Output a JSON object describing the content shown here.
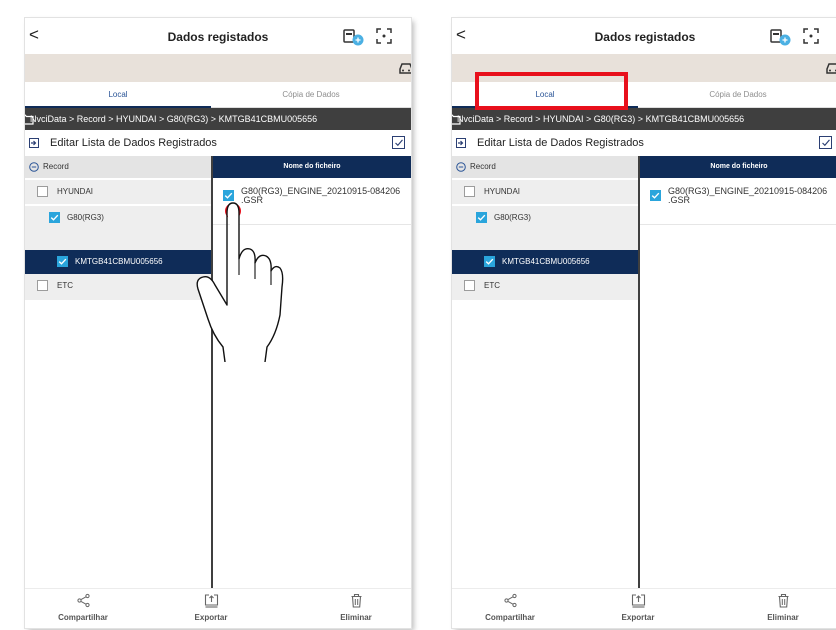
{
  "panels": [
    {
      "title": "Dados registados",
      "back": "<",
      "tabs": {
        "local": "Local",
        "copy": "Cópia de Dados"
      },
      "path": "NvciData > Record > HYUNDAI > G80(RG3) > KMTGB41CBMU005656",
      "edit_label": "Editar Lista de Dados Registrados",
      "tree": {
        "root": "Record",
        "items": [
          {
            "label": "HYUNDAI",
            "checked": false
          },
          {
            "label": "G80(RG3)",
            "checked": true
          },
          {
            "label": "KMTGB41CBMU005656",
            "checked": true,
            "selected": true
          },
          {
            "label": "ETC",
            "checked": false
          }
        ]
      },
      "file_header": "Nome do ficheiro",
      "file_name": "G80(RG3)_ENGINE_20210915-084206\n.GSR",
      "bottom": {
        "share": "Compartilhar",
        "export": "Exportar",
        "delete": "Eliminar"
      }
    },
    {
      "title": "Dados registados",
      "back": "<",
      "tabs": {
        "local": "Local",
        "copy": "Cópia de Dados"
      },
      "path": "NvciData > Record > HYUNDAI > G80(RG3) > KMTGB41CBMU005656",
      "edit_label": "Editar Lista de Dados Registrados",
      "tree": {
        "root": "Record",
        "items": [
          {
            "label": "HYUNDAI",
            "checked": false
          },
          {
            "label": "G80(RG3)",
            "checked": true
          },
          {
            "label": "KMTGB41CBMU005656",
            "checked": true,
            "selected": true
          },
          {
            "label": "ETC",
            "checked": false
          }
        ]
      },
      "file_header": "Nome do ficheiro",
      "file_name": "G80(RG3)_ENGINE_20210915-084206\n.GSR",
      "bottom": {
        "share": "Compartilhar",
        "export": "Exportar",
        "delete": "Eliminar"
      }
    }
  ],
  "colors": {
    "navy": "#0f2c58",
    "check_blue": "#2aa5dc",
    "path_bar": "#3f3f3f",
    "vehicle_bar": "#e8e1da",
    "highlight_red": "#e8101c",
    "tab_active_text": "#2b5597"
  },
  "icons": [
    "back-arrow-icon",
    "vci-connection-icon",
    "screen-capture-icon",
    "car-icon",
    "folder-icon",
    "edit-list-icon",
    "collapse-minus-icon",
    "checkbox-checked-icon",
    "share-icon",
    "export-icon",
    "delete-icon",
    "pointing-hand-icon"
  ]
}
